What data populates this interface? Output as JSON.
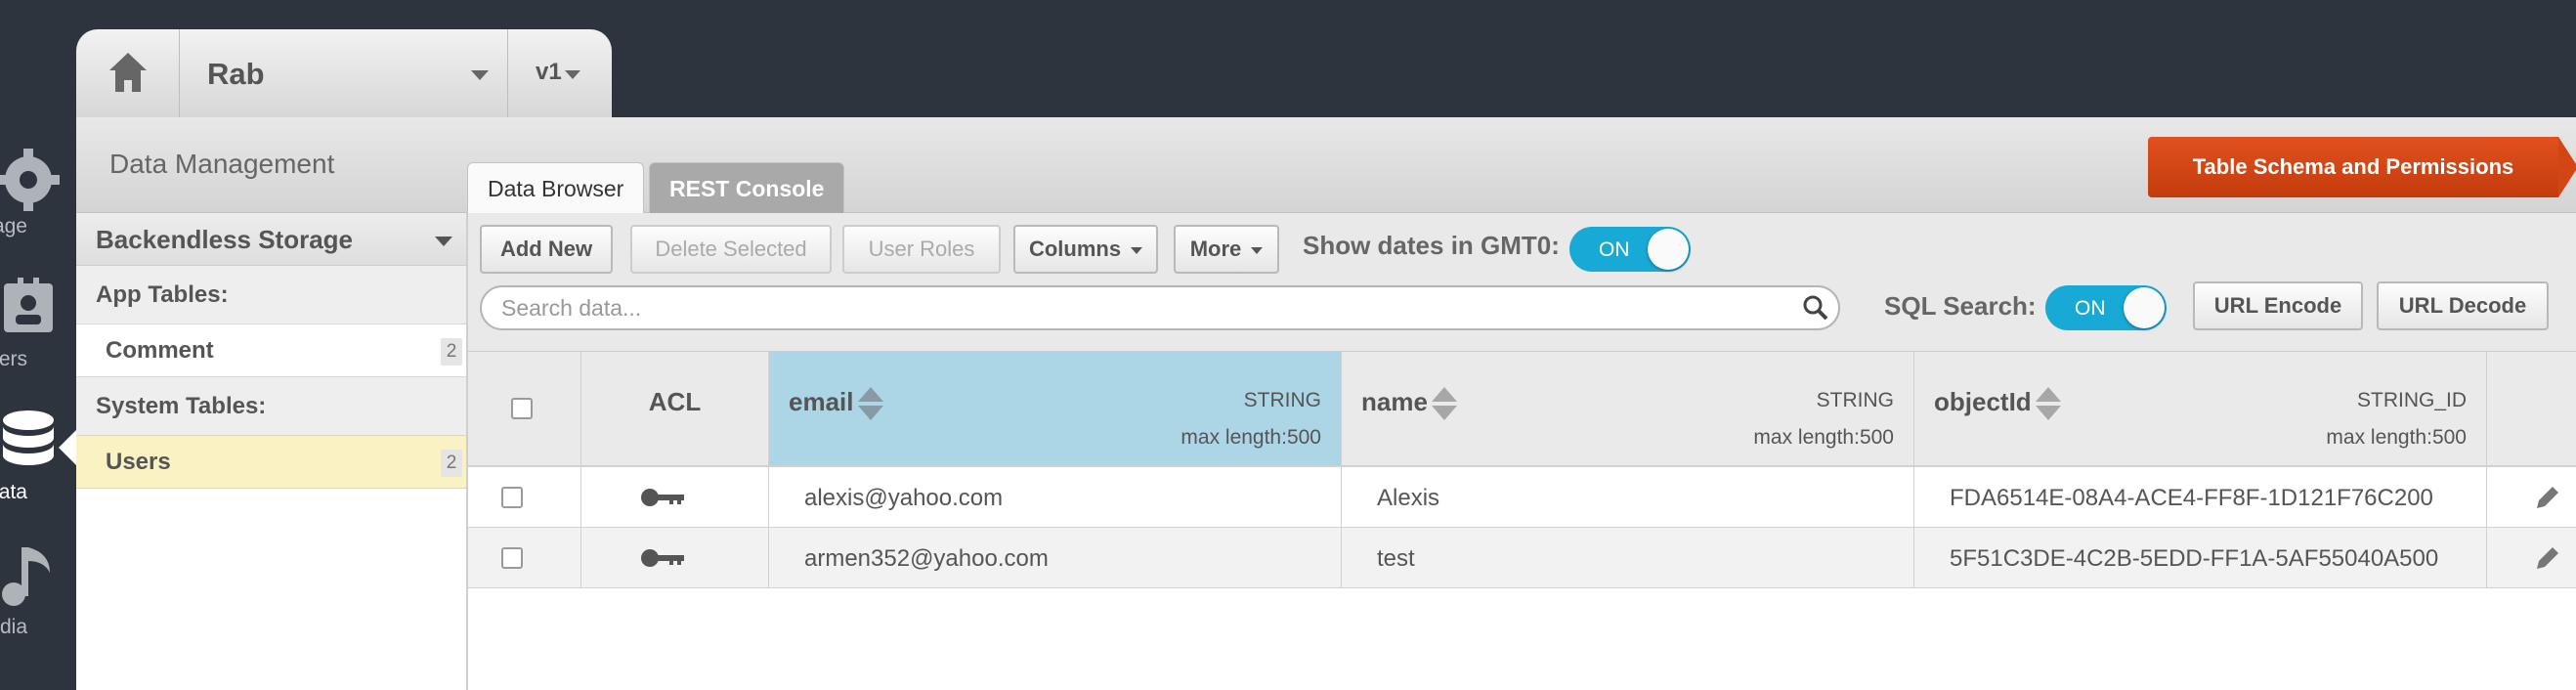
{
  "rail": {
    "items": [
      {
        "label": "age",
        "icon": "gear-icon"
      },
      {
        "label": "ers",
        "icon": "users-icon"
      },
      {
        "label": "ata",
        "icon": "database-icon"
      },
      {
        "label": "dia",
        "icon": "media-icon"
      }
    ]
  },
  "app": {
    "name": "Rab",
    "version": "v1"
  },
  "header": {
    "section_title": "Data Management",
    "tabs": [
      {
        "label": "Data Browser",
        "active": true
      },
      {
        "label": "REST Console",
        "active": false
      }
    ],
    "schema_button": "Table Schema and Permissions"
  },
  "sidebar": {
    "storage": "Backendless Storage",
    "app_tables_label": "App Tables:",
    "app_tables": [
      {
        "label": "Comment",
        "count": "2"
      }
    ],
    "system_tables_label": "System Tables:",
    "system_tables": [
      {
        "label": "Users",
        "count": "2",
        "active": true
      }
    ]
  },
  "toolbar": {
    "add_new": "Add New",
    "delete_selected": "Delete Selected",
    "user_roles": "User Roles",
    "columns": "Columns",
    "more": "More",
    "gmt_label": "Show dates in GMT0:",
    "gmt_toggle": "ON",
    "search_placeholder": "Search data...",
    "sql_label": "SQL Search:",
    "sql_toggle": "ON",
    "url_encode": "URL Encode",
    "url_decode": "URL Decode"
  },
  "table": {
    "acl_header": "ACL",
    "columns": [
      {
        "name": "email",
        "type": "STRING",
        "max": "max length:500"
      },
      {
        "name": "name",
        "type": "STRING",
        "max": "max length:500"
      },
      {
        "name": "objectId",
        "type": "STRING_ID",
        "max": "max length:500"
      }
    ],
    "rows": [
      {
        "email": "alexis@yahoo.com",
        "name": "Alexis",
        "objectId": "FDA6514E-08A4-ACE4-FF8F-1D121F76C200"
      },
      {
        "email": "armen352@yahoo.com",
        "name": "test",
        "objectId": "5F51C3DE-4C2B-5EDD-FF1A-5AF55040A500"
      }
    ]
  },
  "colors": {
    "accent": "#19a9d6",
    "schema_button": "#d24514",
    "highlight_column": "#acd6e5",
    "active_item": "#fbf2c3"
  }
}
